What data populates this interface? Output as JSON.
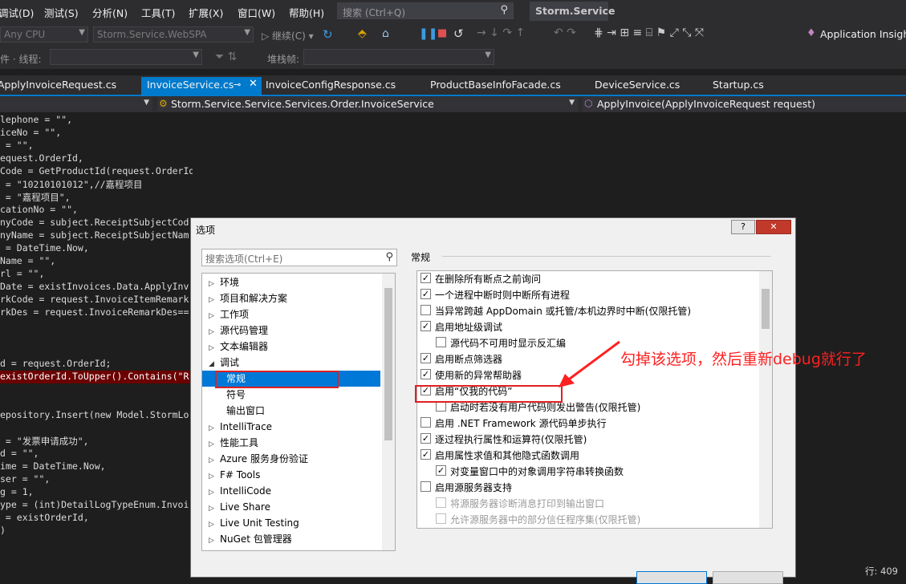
{
  "menubar": {
    "items": [
      "调试(D)",
      "测试(S)",
      "分析(N)",
      "工具(T)",
      "扩展(X)",
      "窗口(W)",
      "帮助(H)"
    ],
    "search_placeholder": "搜索 (Ctrl+Q)",
    "solution_title": "Storm.Service"
  },
  "toolbar": {
    "platform": "Any CPU",
    "startup_project": "Storm.Service.WebSPA",
    "continue_label": "继续(C)",
    "insights_label": "Application Insight",
    "process_label": "件 · 线程:",
    "stackframe_label": "堆栈帧:"
  },
  "tabs": [
    "ApplyInvoiceRequest.cs",
    "InvoiceService.cs",
    "InvoiceConfigResponse.cs",
    "ProductBaseInfoFacade.cs",
    "DeviceService.cs",
    "Startup.cs"
  ],
  "nav": {
    "type_path": "Storm.Service.Service.Services.Order.InvoiceService",
    "member": "ApplyInvoice(ApplyInvoiceRequest request)"
  },
  "code_lines": [
    "lephone = \"\",",
    "iceNo = \"\",",
    " = \"\",",
    "equest.OrderId,",
    "Code = GetProductId(request.OrderId),",
    " = \"10210101012\",//嘉程项目",
    " = \"嘉程项目\",",
    "cationNo = \"\",",
    "nyCode = subject.ReceiptSubjectCod",
    "nyName = subject.ReceiptSubjectNam",
    " = DateTime.Now,",
    "Name = \"\",",
    "rl = \"\",",
    "Date = existInvoices.Data.ApplyInv",
    "rkCode = request.InvoiceItemRemark",
    "rkDes = request.InvoiceRemarkDes==",
    "",
    "",
    "",
    "d = request.OrderId;",
    "existOrderId.ToUpper().Contains(\"R",
    "",
    "",
    "epository.Insert(new Model.StormLo",
    "",
    " = \"发票申请成功\",",
    "d = \"\",",
    "ime = DateTime.Now,",
    "ser = \"\",",
    "g = 1,",
    "ype = (int)DetailLogTypeEnum.Invoi",
    " = existOrderId,",
    ")"
  ],
  "status": {
    "line": "行: 409"
  },
  "dialog": {
    "title": "选项",
    "help_btn": "?",
    "search_placeholder": "搜索选项(Ctrl+E)",
    "tree": [
      {
        "label": "环境",
        "arrow": "▷"
      },
      {
        "label": "项目和解决方案",
        "arrow": "▷"
      },
      {
        "label": "工作项",
        "arrow": "▷"
      },
      {
        "label": "源代码管理",
        "arrow": "▷"
      },
      {
        "label": "文本编辑器",
        "arrow": "▷"
      },
      {
        "label": "调试",
        "arrow": "◢"
      },
      {
        "label": "常规",
        "arrow": ""
      },
      {
        "label": "符号",
        "arrow": ""
      },
      {
        "label": "输出窗口",
        "arrow": ""
      },
      {
        "label": "IntelliTrace",
        "arrow": "▷"
      },
      {
        "label": "性能工具",
        "arrow": "▷"
      },
      {
        "label": "Azure 服务身份验证",
        "arrow": "▷"
      },
      {
        "label": "F# Tools",
        "arrow": "▷"
      },
      {
        "label": "IntelliCode",
        "arrow": "▷"
      },
      {
        "label": "Live Share",
        "arrow": "▷"
      },
      {
        "label": "Live Unit Testing",
        "arrow": "▷"
      },
      {
        "label": "NuGet 包管理器",
        "arrow": "▷"
      }
    ],
    "section_title": "常规",
    "options": [
      {
        "label": "在删除所有断点之前询问",
        "checked": true,
        "indent": 0,
        "disabled": false
      },
      {
        "label": "一个进程中断时则中断所有进程",
        "checked": true,
        "indent": 0,
        "disabled": false
      },
      {
        "label": "当异常跨越 AppDomain 或托管/本机边界时中断(仅限托管)",
        "checked": false,
        "indent": 0,
        "disabled": false
      },
      {
        "label": "启用地址级调试",
        "checked": true,
        "indent": 0,
        "disabled": false
      },
      {
        "label": "源代码不可用时显示反汇编",
        "checked": false,
        "indent": 1,
        "disabled": false
      },
      {
        "label": "启用断点筛选器",
        "checked": true,
        "indent": 0,
        "disabled": false
      },
      {
        "label": "使用新的异常帮助器",
        "checked": true,
        "indent": 0,
        "disabled": false
      },
      {
        "label": "启用“仅我的代码”",
        "checked": true,
        "indent": 0,
        "disabled": false
      },
      {
        "label": "启动时若没有用户代码则发出警告(仅限托管)",
        "checked": false,
        "indent": 1,
        "disabled": false
      },
      {
        "label": "启用 .NET Framework 源代码单步执行",
        "checked": false,
        "indent": 0,
        "disabled": false
      },
      {
        "label": "逐过程执行属性和运算符(仅限托管)",
        "checked": true,
        "indent": 0,
        "disabled": false
      },
      {
        "label": "启用属性求值和其他隐式函数调用",
        "checked": true,
        "indent": 0,
        "disabled": false
      },
      {
        "label": "对变量窗口中的对象调用字符串转换函数",
        "checked": true,
        "indent": 1,
        "disabled": false
      },
      {
        "label": "启用源服务器支持",
        "checked": false,
        "indent": 0,
        "disabled": false
      },
      {
        "label": "将源服务器诊断消息打印到输出窗口",
        "checked": false,
        "indent": 1,
        "disabled": true
      },
      {
        "label": "允许源服务器中的部分信任程序集(仅限托管)",
        "checked": false,
        "indent": 1,
        "disabled": true
      }
    ]
  },
  "annotation": "勾掉该选项，然后重新debug就行了",
  "colors": {
    "accent": "#007acc",
    "highlight_red": "#e02020",
    "selection": "#0078d7"
  }
}
